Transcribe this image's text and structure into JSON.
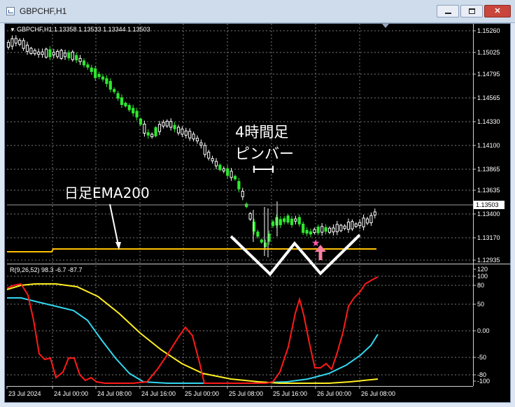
{
  "window": {
    "title": "GBPCHF,H1",
    "min_label": "",
    "max_label": "",
    "close_label": "✕"
  },
  "chart": {
    "info": "GBPCHF,H1  1.13358 1.13533 1.13344 1.13503",
    "price_axis": [
      "1.15260",
      "1.15025",
      "1.14795",
      "1.14565",
      "1.14330",
      "1.14100",
      "1.13865",
      "1.13635",
      "1.13400",
      "1.13170",
      "1.12935"
    ],
    "current_price": "1.13503",
    "annotations": {
      "ema_label": "日足EMA200",
      "pinbar_line1": "4時間足",
      "pinbar_line2": "ピンバー"
    }
  },
  "indicator": {
    "info": "R(9,26,52) 98.3 -6.7 -87.7",
    "axis": [
      "120",
      "100",
      "80",
      "50",
      "0.00",
      "-50",
      "-80",
      "-100"
    ]
  },
  "time_axis": [
    "23 Jul 2024",
    "24 Jul 00:00",
    "24 Jul 08:00",
    "24 Jul 16:00",
    "25 Jul 00:00",
    "25 Jul 08:00",
    "25 Jul 16:00",
    "26 Jul 00:00",
    "26 Jul 08:00"
  ],
  "colors": {
    "bull": "#ffffff",
    "bear": "#2ee82e",
    "ema": "#ffc000",
    "red": "#ff1a1a",
    "cyan": "#33d6f0",
    "yellow": "#ffee22",
    "grid": "#8a8a8a"
  }
}
